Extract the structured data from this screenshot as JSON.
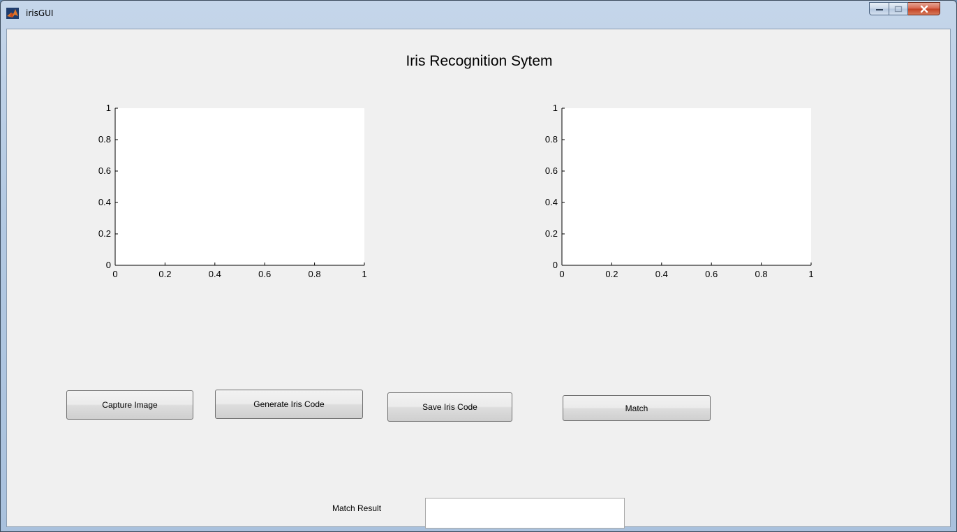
{
  "window": {
    "title": "irisGUI",
    "icon": "matlab-icon",
    "controls": {
      "minimize": "minimize-icon",
      "maximize": "maximize-icon",
      "close": "close-icon"
    }
  },
  "heading": "Iris Recognition Sytem",
  "axes": [
    {
      "name": "left-axes",
      "x_ticks": [
        "0",
        "0.2",
        "0.4",
        "0.6",
        "0.8",
        "1"
      ],
      "y_ticks": [
        "0",
        "0.2",
        "0.4",
        "0.6",
        "0.8",
        "1"
      ],
      "xlim": [
        0,
        1
      ],
      "ylim": [
        0,
        1
      ]
    },
    {
      "name": "right-axes",
      "x_ticks": [
        "0",
        "0.2",
        "0.4",
        "0.6",
        "0.8",
        "1"
      ],
      "y_ticks": [
        "0",
        "0.2",
        "0.4",
        "0.6",
        "0.8",
        "1"
      ],
      "xlim": [
        0,
        1
      ],
      "ylim": [
        0,
        1
      ]
    }
  ],
  "buttons": {
    "capture": "Capture Image",
    "generate": "Generate Iris Code",
    "save": "Save Iris Code",
    "match": "Match"
  },
  "match_result": {
    "label": "Match Result",
    "value": ""
  }
}
